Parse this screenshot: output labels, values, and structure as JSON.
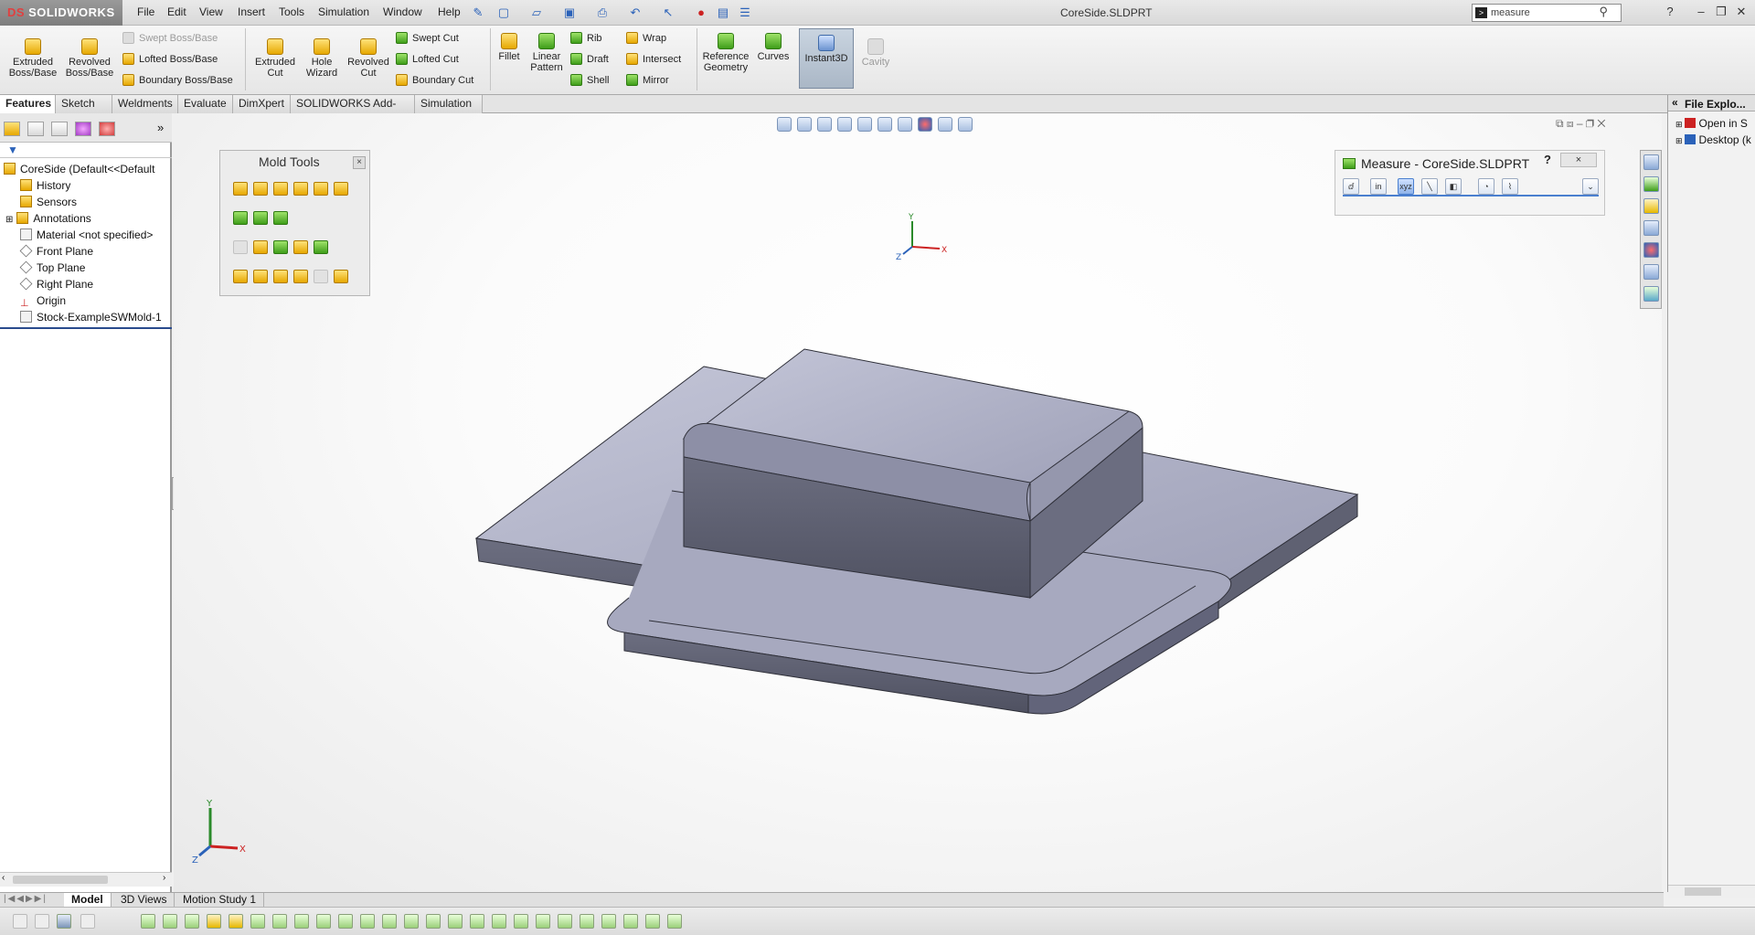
{
  "app": {
    "brand": "SOLIDWORKS",
    "document_title": "CoreSide.SLDPRT"
  },
  "menu": [
    "File",
    "Edit",
    "View",
    "Insert",
    "Tools",
    "Simulation",
    "Window",
    "Help"
  ],
  "search": {
    "value": "measure"
  },
  "ribbon": {
    "extruded_boss": "Extruded Boss/Base",
    "revolved_boss": "Revolved Boss/Base",
    "swept_boss": "Swept Boss/Base",
    "lofted_boss": "Lofted Boss/Base",
    "boundary_boss": "Boundary Boss/Base",
    "extruded_cut": "Extruded Cut",
    "hole_wizard": "Hole Wizard",
    "revolved_cut": "Revolved Cut",
    "swept_cut": "Swept Cut",
    "lofted_cut": "Lofted Cut",
    "boundary_cut": "Boundary Cut",
    "fillet": "Fillet",
    "linear_pattern": "Linear Pattern",
    "rib": "Rib",
    "draft": "Draft",
    "shell": "Shell",
    "wrap": "Wrap",
    "intersect": "Intersect",
    "mirror": "Mirror",
    "reference_geometry": "Reference Geometry",
    "curves": "Curves",
    "instant3d": "Instant3D",
    "cavity": "Cavity"
  },
  "command_tabs": [
    "Features",
    "Sketch",
    "Weldments",
    "Evaluate",
    "DimXpert",
    "SOLIDWORKS Add-Ins",
    "Simulation"
  ],
  "feature_tree": {
    "root": "CoreSide  (Default<<Default",
    "items": [
      "History",
      "Sensors",
      "Annotations",
      "Material <not specified>",
      "Front Plane",
      "Top Plane",
      "Right Plane",
      "Origin",
      "Stock-ExampleSWMold-1"
    ]
  },
  "mold_tools": {
    "title": "Mold Tools",
    "close": "×"
  },
  "measure": {
    "title": "Measure - CoreSide.SLDPRT",
    "help": "?",
    "close": "×",
    "units_in": "in",
    "units_mm": "mm"
  },
  "task_pane": {
    "title": "File Explo...",
    "items": [
      "Open in S",
      "Desktop (k"
    ]
  },
  "bottom_tabs": [
    "Model",
    "3D Views",
    "Motion Study 1"
  ],
  "colors": {
    "accent": "#4a7fcf",
    "part_face": "#a9abc2",
    "part_side": "#5b5d6d"
  }
}
